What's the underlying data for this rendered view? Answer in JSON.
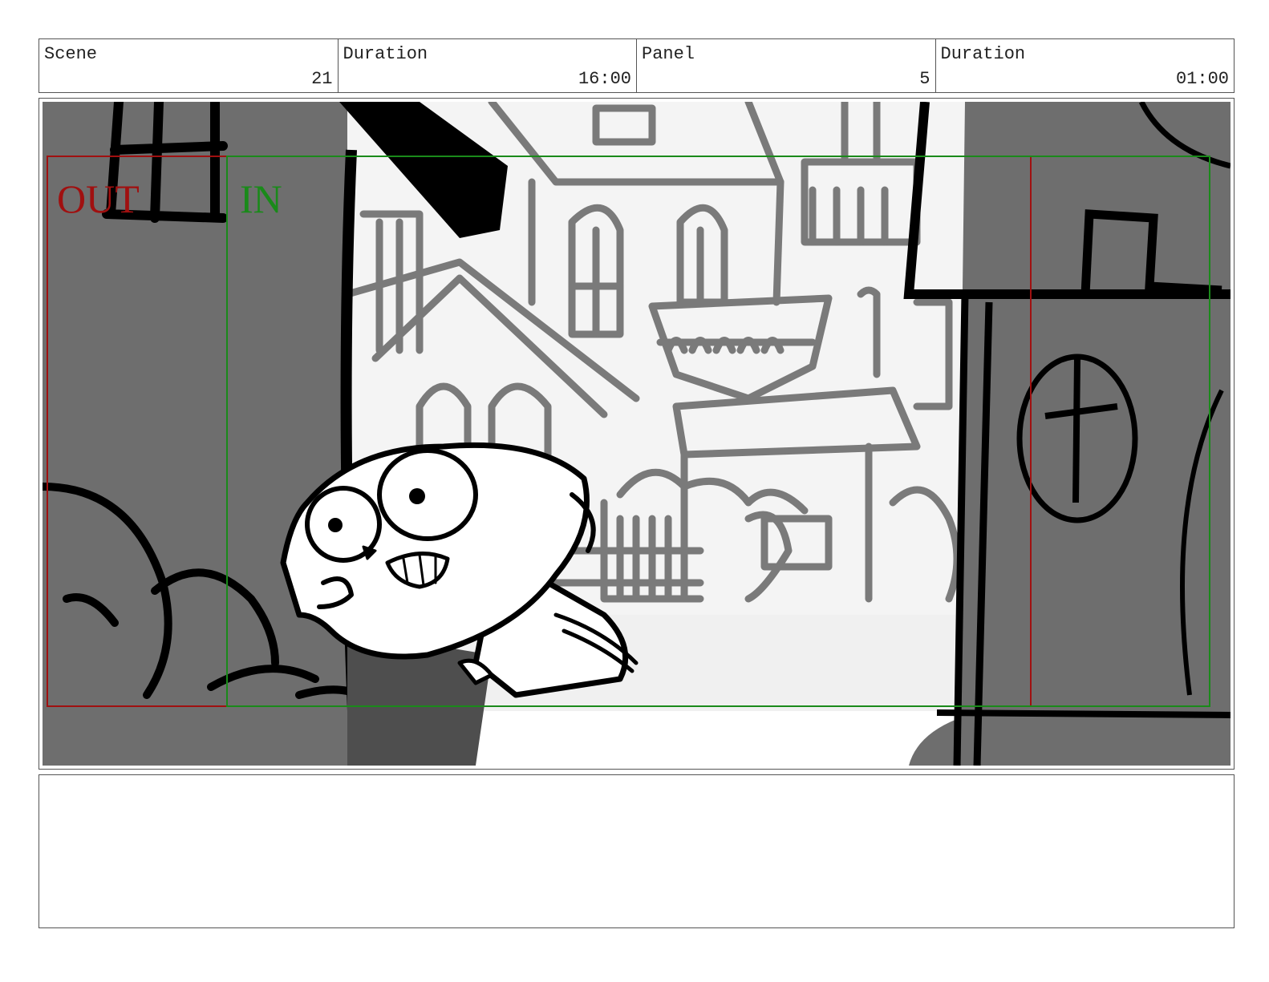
{
  "header": {
    "scene_label": "Scene",
    "scene_value": "21",
    "scene_duration_label": "Duration",
    "scene_duration_value": "16:00",
    "panel_label": "Panel",
    "panel_value": "5",
    "panel_duration_label": "Duration",
    "panel_duration_value": "01:00"
  },
  "frame": {
    "out_label": "OUT",
    "in_label": "IN",
    "out_color": "#a01010",
    "in_color": "#1a8a1a"
  },
  "notes": {
    "text": ""
  }
}
